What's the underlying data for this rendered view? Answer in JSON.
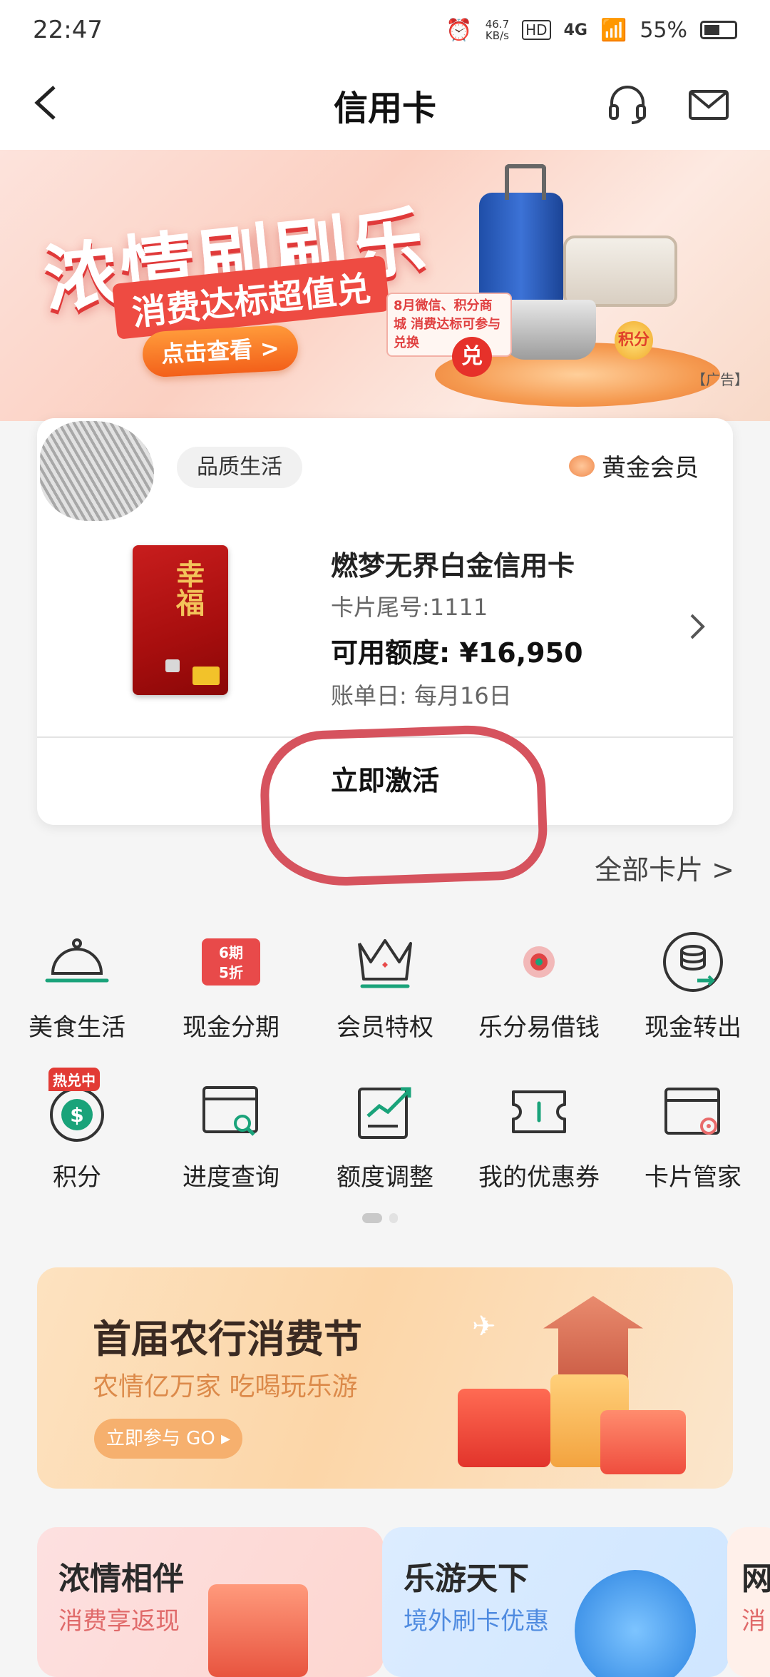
{
  "status_bar": {
    "time": "22:47",
    "net_speed_value": "46.7",
    "net_speed_unit": "KB/s",
    "hd": "HD",
    "network": "4G",
    "battery": "55%"
  },
  "nav": {
    "title": "信用卡"
  },
  "banner": {
    "title": "浓情刷刷乐",
    "subtitle": "消费达标超值兑",
    "button": "点击查看 >",
    "note": "8月微信、积分商城 消费达标可参与兑换",
    "dui": "兑",
    "points": "积分",
    "ad_label": "【广告】"
  },
  "card_panel": {
    "tag": "品质生活",
    "member": "黄金会员",
    "card_art_text": "幸福",
    "card_name": "燃梦无界白金信用卡",
    "card_tail": "卡片尾号:1111",
    "card_limit": "可用额度: ¥16,950",
    "card_bill": "账单日: 每月16日",
    "activate": "立即激活"
  },
  "all_cards": "全部卡片 >",
  "menu": {
    "row1": [
      {
        "label": "美食生活",
        "icon": "dining-bell-icon"
      },
      {
        "label": "现金分期",
        "icon": "installment-icon",
        "badge_line1": "6期",
        "badge_line2": "5折"
      },
      {
        "label": "会员特权",
        "icon": "crown-icon"
      },
      {
        "label": "乐分易借钱",
        "icon": "loan-icon"
      },
      {
        "label": "现金转出",
        "icon": "cash-transfer-icon"
      }
    ],
    "row2": [
      {
        "label": "积分",
        "icon": "points-icon",
        "hot": "热兑中"
      },
      {
        "label": "进度查询",
        "icon": "progress-search-icon"
      },
      {
        "label": "额度调整",
        "icon": "limit-adjust-icon"
      },
      {
        "label": "我的优惠券",
        "icon": "coupon-icon"
      },
      {
        "label": "卡片管家",
        "icon": "card-manager-icon"
      }
    ]
  },
  "festival": {
    "title": "首届农行消费节",
    "subtitle": "农情亿万家 吃喝玩乐游",
    "button": "立即参与 GO ▸"
  },
  "promos": [
    {
      "title": "浓情相伴",
      "subtitle": "消费享返现"
    },
    {
      "title": "乐游天下",
      "subtitle": "境外刷卡优惠"
    },
    {
      "title": "网",
      "subtitle": "消"
    }
  ],
  "colors": {
    "accent_green": "#1aa37a",
    "red": "#e23b35",
    "annotation_circle": "#d6535e"
  }
}
